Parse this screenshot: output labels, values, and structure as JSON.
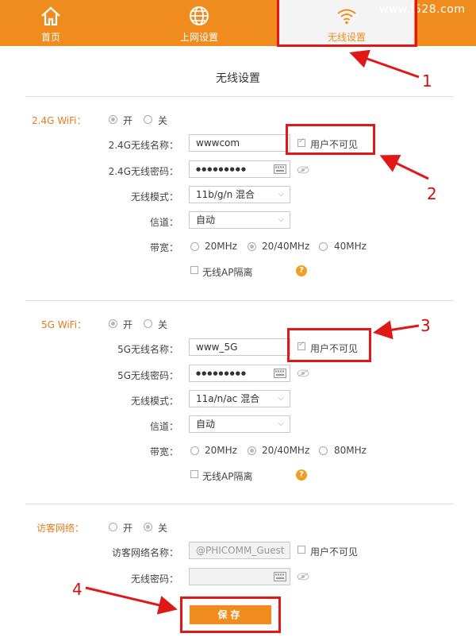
{
  "nav": {
    "home": "首页",
    "internet": "上网设置",
    "wireless": "无线设置"
  },
  "watermark": "www.i528.com",
  "page_title": "无线设置",
  "wifi24": {
    "label": "2.4G WiFi：",
    "on": "开",
    "off": "关",
    "name_label": "2.4G无线名称：",
    "name_value": "wwwcom",
    "hidden_label": "用户不可见",
    "pwd_label": "2.4G无线密码：",
    "pwd_value": "●●●●●●●●●",
    "mode_label": "无线模式：",
    "mode_value": "11b/g/n 混合",
    "channel_label": "信道：",
    "channel_value": "自动",
    "bw_label": "带宽：",
    "bw1": "20MHz",
    "bw2": "20/40MHz",
    "bw3": "40MHz",
    "ap_iso": "无线AP隔离"
  },
  "wifi5": {
    "label": "5G WiFi：",
    "on": "开",
    "off": "关",
    "name_label": "5G无线名称：",
    "name_value": "www_5G",
    "hidden_label": "用户不可见",
    "pwd_label": "5G无线密码：",
    "pwd_value": "●●●●●●●●●",
    "mode_label": "无线模式：",
    "mode_value": "11a/n/ac 混合",
    "channel_label": "信道：",
    "channel_value": "自动",
    "bw_label": "带宽：",
    "bw1": "20MHz",
    "bw2": "20/40MHz",
    "bw3": "80MHz",
    "ap_iso": "无线AP隔离"
  },
  "guest": {
    "label": "访客网络：",
    "on": "开",
    "off": "关",
    "name_label": "访客网络名称：",
    "name_value": "@PHICOMM_Guest",
    "hidden_label": "用户不可见",
    "pwd_label": "无线密码：",
    "pwd_value": ""
  },
  "help_glyph": "?",
  "save": "保存",
  "annotations": [
    "1",
    "2",
    "3",
    "4"
  ],
  "colors": {
    "brand": "#f08c1e",
    "annotation": "#e01818"
  }
}
